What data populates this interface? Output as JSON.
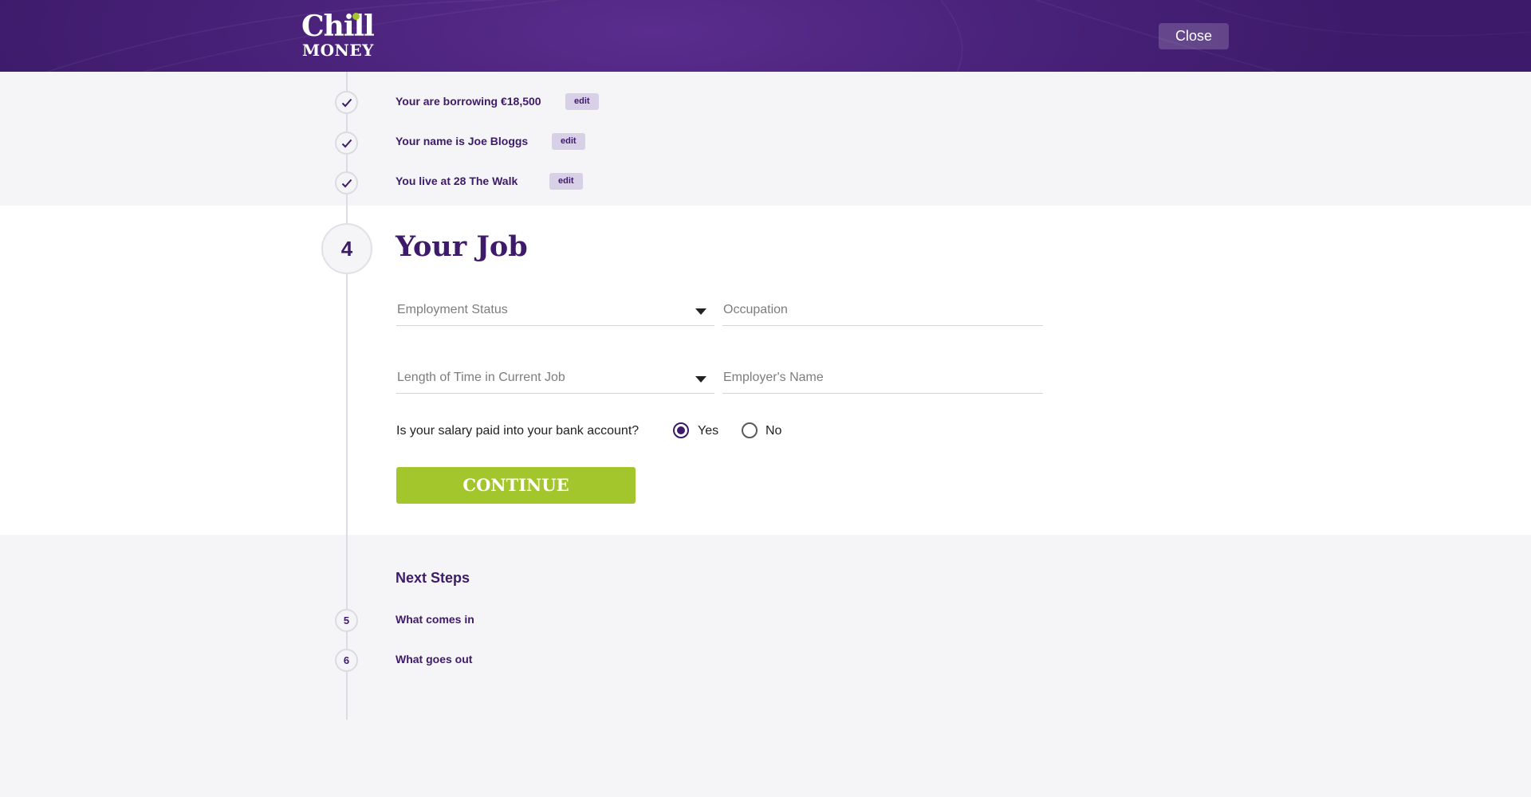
{
  "header": {
    "logo": {
      "line1": "Chill",
      "line2": "MONEY"
    },
    "close_label": "Close"
  },
  "completed_steps": [
    {
      "text": "Your are borrowing €18,500",
      "edit_label": "edit",
      "icon": "check-icon"
    },
    {
      "text": "Your name is Joe Bloggs",
      "edit_label": "edit",
      "icon": "check-icon"
    },
    {
      "text": "You live at 28 The Walk",
      "edit_label": "edit",
      "icon": "check-icon"
    }
  ],
  "current_step": {
    "number": "4",
    "title": "Your Job",
    "fields": {
      "employment_status": {
        "placeholder": "Employment Status",
        "type": "select"
      },
      "occupation": {
        "placeholder": "Occupation",
        "type": "text"
      },
      "time_in_job": {
        "placeholder": "Length of Time in Current Job",
        "type": "select"
      },
      "employer_name": {
        "placeholder": "Employer's Name",
        "type": "text"
      }
    },
    "salary_question": "Is your salary paid into your bank account?",
    "salary_options": [
      {
        "label": "Yes",
        "selected": true
      },
      {
        "label": "No",
        "selected": false
      }
    ],
    "continue_label": "CONTINUE"
  },
  "next_steps": {
    "heading": "Next Steps",
    "items": [
      {
        "number": "5",
        "text": "What comes in"
      },
      {
        "number": "6",
        "text": "What goes out"
      }
    ]
  },
  "colors": {
    "brand_purple": "#3d1a6a",
    "accent_green": "#a3c62c",
    "edit_badge": "#d8d0e6"
  }
}
